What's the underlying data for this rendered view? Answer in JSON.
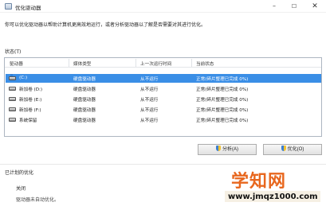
{
  "window": {
    "title": "优化驱动器"
  },
  "intro": "你可以优化驱动器以帮助计算机更高效地运行，或者分析驱动器以了解是否需要对其进行优化。",
  "status": {
    "label": "状态(T)",
    "columns": [
      "驱动器",
      "媒体类型",
      "上一次运行时间",
      "当前状态"
    ],
    "rows": [
      {
        "drive": "(C:)",
        "media": "硬盘驱动器",
        "last_run": "从不运行",
        "state": "正常(碎片整理已完成 0%)",
        "icon": "system-drive-icon",
        "selected": true
      },
      {
        "drive": "新加卷 (D:)",
        "media": "硬盘驱动器",
        "last_run": "从不运行",
        "state": "正常(碎片整理已完成 0%)",
        "icon": "drive-icon",
        "selected": false
      },
      {
        "drive": "新加卷 (E:)",
        "media": "硬盘驱动器",
        "last_run": "从不运行",
        "state": "正常(碎片整理已完成 0%)",
        "icon": "drive-icon",
        "selected": false
      },
      {
        "drive": "新加卷 (F:)",
        "media": "硬盘驱动器",
        "last_run": "从不运行",
        "state": "正常(碎片整理已完成 0%)",
        "icon": "drive-icon",
        "selected": false
      },
      {
        "drive": "系统保留",
        "media": "硬盘驱动器",
        "last_run": "从不运行",
        "state": "正常(碎片整理已完成 0%)",
        "icon": "drive-icon",
        "selected": false
      }
    ]
  },
  "buttons": {
    "analyze": "分析(A)",
    "optimize": "优化(O)"
  },
  "scheduled": {
    "label": "已计划的优化",
    "state": "关闭",
    "desc": "驱动器未自动优化。"
  },
  "watermark": {
    "brand": "学知网",
    "url": "www.jmqz1000.com"
  },
  "colors": {
    "selection": "#3a8ee6",
    "watermark": "#e8671e"
  }
}
